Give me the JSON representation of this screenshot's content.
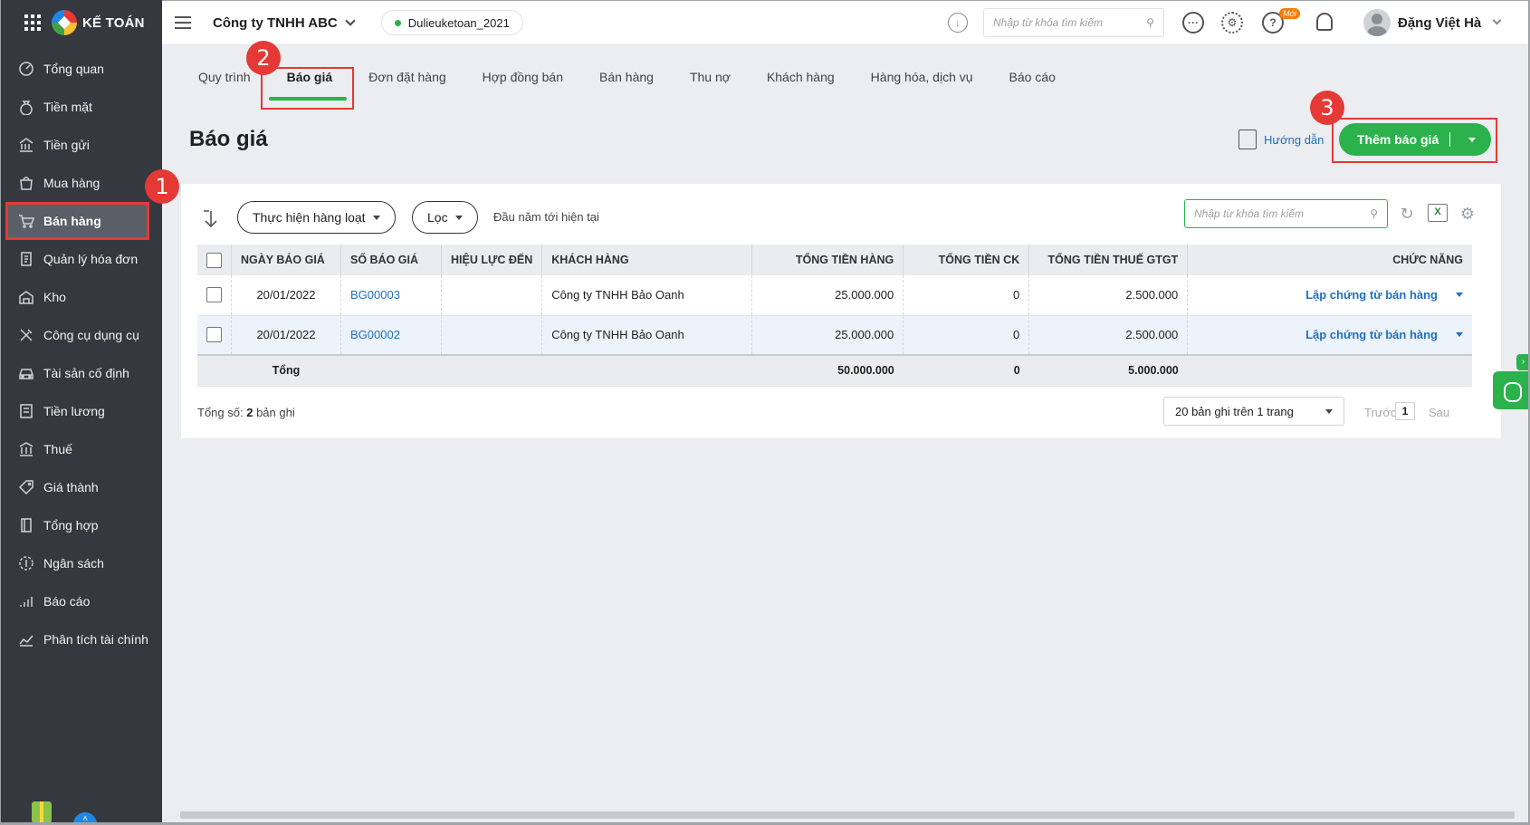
{
  "app": {
    "brand": "KẾ TOÁN"
  },
  "sidebar": {
    "items": [
      {
        "label": "Tổng quan",
        "icon": "dashboard-icon"
      },
      {
        "label": "Tiền mặt",
        "icon": "money-bag-icon"
      },
      {
        "label": "Tiền gửi",
        "icon": "bank-icon"
      },
      {
        "label": "Mua hàng",
        "icon": "shopping-bag-icon"
      },
      {
        "label": "Bán hàng",
        "icon": "cart-icon",
        "active": true
      },
      {
        "label": "Quản lý hóa đơn",
        "icon": "invoice-icon"
      },
      {
        "label": "Kho",
        "icon": "warehouse-icon"
      },
      {
        "label": "Công cụ dụng cụ",
        "icon": "tools-icon"
      },
      {
        "label": "Tài sản cố định",
        "icon": "car-icon"
      },
      {
        "label": "Tiền lương",
        "icon": "payroll-icon"
      },
      {
        "label": "Thuế",
        "icon": "tax-icon"
      },
      {
        "label": "Giá thành",
        "icon": "price-tag-icon"
      },
      {
        "label": "Tổng hợp",
        "icon": "ledger-icon"
      },
      {
        "label": "Ngân sách",
        "icon": "budget-icon"
      },
      {
        "label": "Báo cáo",
        "icon": "report-icon"
      },
      {
        "label": "Phân tích tài chính",
        "icon": "analytics-icon"
      }
    ]
  },
  "header": {
    "company": "Công ty TNHH ABC",
    "database": "Dulieuketoan_2021",
    "search_placeholder": "Nhập từ khóa tìm kiếm",
    "new_tag": "Mới",
    "user_name": "Đặng Việt Hà"
  },
  "tabs": [
    {
      "label": "Quy trình"
    },
    {
      "label": "Báo giá",
      "active": true
    },
    {
      "label": "Đơn đặt hàng"
    },
    {
      "label": "Hợp đồng bán"
    },
    {
      "label": "Bán hàng"
    },
    {
      "label": "Thu nợ"
    },
    {
      "label": "Khách hàng"
    },
    {
      "label": "Hàng hóa, dịch vụ"
    },
    {
      "label": "Báo cáo"
    }
  ],
  "annotations": {
    "step1": "1",
    "step2": "2",
    "step3": "3"
  },
  "page": {
    "title": "Báo giá",
    "guide_label": "Hướng dẫn",
    "add_button": "Thêm báo giá"
  },
  "toolbar": {
    "bulk_action": "Thực hiện hàng loạt",
    "filter": "Lọc",
    "date_range": "Đầu năm tới hiện tại",
    "search_placeholder": "Nhập từ khóa tìm kiếm",
    "excel_label": "X"
  },
  "table": {
    "headers": {
      "date": "NGÀY BÁO GIÁ",
      "number": "SỐ BÁO GIÁ",
      "valid_until": "HIỆU LỰC ĐẾN",
      "customer": "KHÁCH HÀNG",
      "total_goods": "TỔNG TIỀN HÀNG",
      "total_discount": "TỔNG TIỀN CK",
      "total_vat": "TỔNG TIỀN THUẾ GTGT",
      "action": "CHỨC NĂNG"
    },
    "rows": [
      {
        "date": "20/01/2022",
        "number": "BG00003",
        "valid_until": "",
        "customer": "Công ty TNHH Bảo Oanh",
        "total_goods": "25.000.000",
        "total_discount": "0",
        "total_vat": "2.500.000",
        "action": "Lập chứng từ bán hàng"
      },
      {
        "date": "20/01/2022",
        "number": "BG00002",
        "valid_until": "",
        "customer": "Công ty TNHH Bảo Oanh",
        "total_goods": "25.000.000",
        "total_discount": "0",
        "total_vat": "2.500.000",
        "action": "Lập chứng từ bán hàng"
      }
    ],
    "totals": {
      "label": "Tổng",
      "total_goods": "50.000.000",
      "total_discount": "0",
      "total_vat": "5.000.000"
    }
  },
  "footer": {
    "total_prefix": "Tổng số:",
    "total_count": "2",
    "total_suffix": "bản ghi",
    "page_size": "20 bản ghi trên 1 trang",
    "prev": "Trước",
    "current_page": "1",
    "next": "Sau"
  },
  "colors": {
    "accent_green": "#2bb24c",
    "sidebar_bg": "#35383e",
    "annotation_red": "#e53935",
    "link_blue": "#1f70c1"
  }
}
